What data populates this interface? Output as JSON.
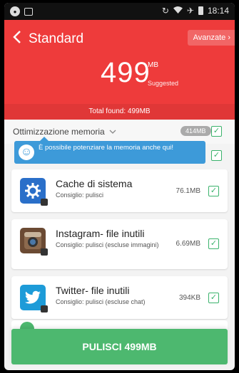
{
  "status_bar": {
    "time": "18:14",
    "left_icons": [
      "notification-icon",
      "screenshot-icon"
    ],
    "right_icons": [
      "sync-icon",
      "wifi-icon",
      "airplane-icon",
      "battery-icon"
    ]
  },
  "header": {
    "back_icon": "back-arrow-icon",
    "title": "Standard",
    "advanced_label": "Avanzate",
    "advanced_icon": "chevron-right-icon",
    "big_value": "499",
    "big_unit": "MB",
    "suggested": "Suggested",
    "total_found": "Total found: 499MB",
    "color": "#ee3b3b"
  },
  "memory": {
    "label": "Ottimizzazione memoria",
    "expand_icon": "chevron-down-icon",
    "size": "414MB",
    "checked": true
  },
  "tooltip": {
    "icon": "smiley-icon",
    "text": "È possibile potenziare la memoria anche qui!"
  },
  "items": [
    {
      "icon": "settings-gear-icon",
      "icon_color": "#2a6fc9",
      "title": "Cache di sistema",
      "subtitle": "Consiglio: pulisci",
      "size": "76.1MB",
      "checked": true
    },
    {
      "icon": "instagram-camera-icon",
      "icon_color": "#6b4a33",
      "title": "Instagram- file inutili",
      "subtitle": "Consiglio: pulisci (escluse immagini)",
      "size": "6.69MB",
      "checked": true
    },
    {
      "icon": "twitter-bird-icon",
      "icon_color": "#1d9bd8",
      "title": "Twitter- file inutili",
      "subtitle": "Consiglio: pulisci (escluse chat)",
      "size": "394KB",
      "checked": true
    }
  ],
  "clean_button": {
    "label": "PULISCI 499MB",
    "color": "#4db86f"
  },
  "check_mark": "✓"
}
